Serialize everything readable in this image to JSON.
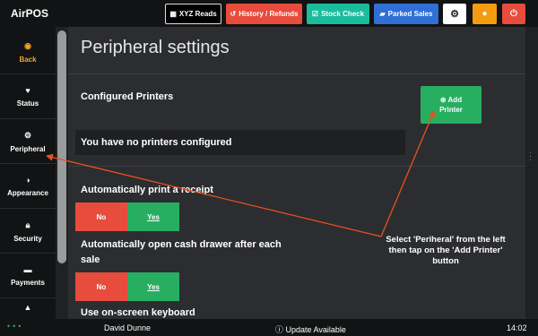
{
  "app": {
    "brand": "AirPOS"
  },
  "topbar": {
    "xyz_reads": "XYZ Reads",
    "history_refunds": "History / Refunds",
    "stock_check": "Stock Check",
    "parked_sales": "Parked Sales",
    "settings_icon": "gear-icon",
    "user_icon": "user-icon",
    "power_icon": "power-icon",
    "colors": {
      "xyz": "#111111",
      "history": "#e74c3c",
      "stock": "#1abc9c",
      "parked": "#2f6fd6",
      "settings": "#ffffff",
      "user": "#f39c12",
      "power": "#e74c3c"
    }
  },
  "sidebar": {
    "items": [
      {
        "label": "Back",
        "icon": "back-circle-icon"
      },
      {
        "label": "Status",
        "icon": "heartbeat-icon"
      },
      {
        "label": "Peripheral",
        "icon": "gear-icon"
      },
      {
        "label": "Appearance",
        "icon": "contrast-icon"
      },
      {
        "label": "Security",
        "icon": "lock-icon"
      },
      {
        "label": "Payments",
        "icon": "cart-icon"
      },
      {
        "label": "",
        "icon": "warning-icon"
      }
    ]
  },
  "main": {
    "title": "Peripheral settings",
    "configured_printers": "Configured Printers",
    "add_printer_line1": "Add",
    "add_printer_line2": "Printer",
    "no_printers": "You have no printers configured",
    "auto_print": "Automatically print a receipt",
    "auto_drawer": "Automatically open cash drawer after each sale",
    "onscreen_keyboard": "Use on-screen keyboard",
    "toggle_no": "No",
    "toggle_yes": "Yes",
    "auto_print_value": "Yes",
    "auto_drawer_value": "Yes"
  },
  "annotation": {
    "text": "Select 'Periheral' from the left then tap on the 'Add Printer' button",
    "color": "#e8521c"
  },
  "statusbar": {
    "user": "David Dunne",
    "update": "Update Available",
    "time": "14:02"
  }
}
